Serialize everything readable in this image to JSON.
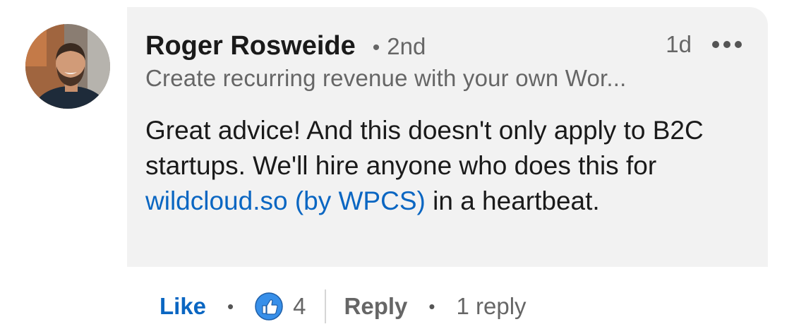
{
  "comment": {
    "author_name": "Roger Rosweide",
    "degree_separator": "•",
    "degree": "2nd",
    "time_ago": "1d",
    "more_icon": "more-horizontal-icon",
    "headline": "Create recurring revenue with your own Wor...",
    "body_before_link": "Great advice! And this doesn't only apply to B2C startups. We'll hire anyone who does this for ",
    "link_text": "wildcloud.so (by WPCS)",
    "body_after_link": " in a heartbeat."
  },
  "actions": {
    "like_label": "Like",
    "separator": "•",
    "reaction_icon": "thumbs-up-icon",
    "reaction_count": "4",
    "reply_label": "Reply",
    "reply_count_label": "1 reply"
  },
  "colors": {
    "link": "#0a66c2",
    "bubble_background": "#f2f2f2",
    "secondary_text": "#666666"
  }
}
